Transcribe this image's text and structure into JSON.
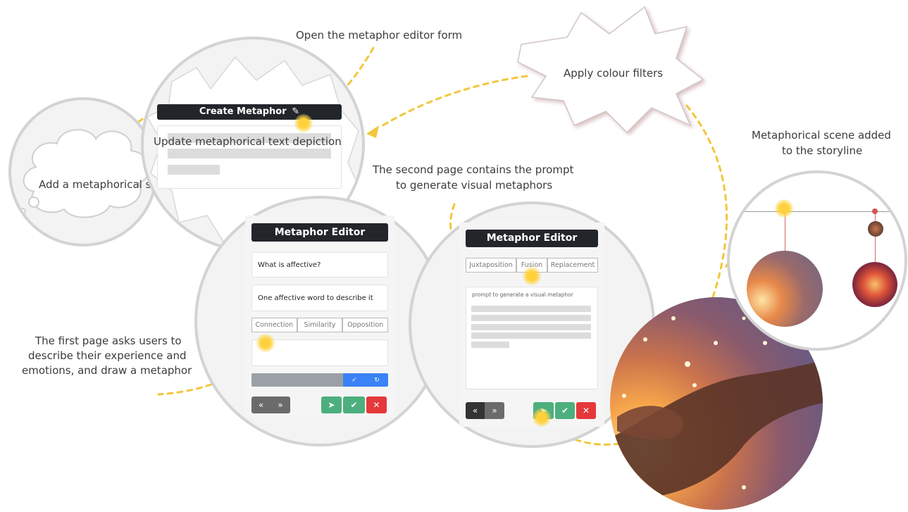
{
  "captions": {
    "open_form": "Open the metaphor editor form",
    "apply_filters": "Apply colour filters",
    "add_scene": "Add a metaphorical scene",
    "scene_added_line1": "Metaphorical scene added",
    "scene_added_line2": "to the storyline",
    "second_page_line1": "The second page contains the prompt",
    "second_page_line2": "to generate visual metaphors",
    "first_page_line1": "The first page asks users to",
    "first_page_line2": "describe their experience and",
    "first_page_line3": "emotions, and draw a metaphor"
  },
  "create_panel": {
    "title": "Create Metaphor",
    "update_text": "Update metaphorical text depiction"
  },
  "editor1": {
    "title": "Metaphor Editor",
    "question": "What is affective?",
    "word_prompt": "One affective word to describe it",
    "tabs": [
      "Connection",
      "Similarity",
      "Opposition"
    ]
  },
  "editor2": {
    "title": "Metaphor Editor",
    "tabs": [
      "Juxtaposition",
      "Fusion",
      "Replacement"
    ],
    "prompt_placeholder": "prompt to generate a visual metaphor"
  },
  "colors": {
    "dash": "#f3c63b",
    "title_bg": "#22262b",
    "green": "#4caf7d",
    "red": "#e5383b",
    "blue": "#3b82f6",
    "dark_btn": "#333333"
  },
  "icons": {
    "pencil": "pencil-icon",
    "prev": "double-chevron-left-icon",
    "next": "double-chevron-right-icon",
    "send": "send-icon",
    "check": "check-icon",
    "close": "close-icon",
    "refresh": "refresh-icon"
  }
}
